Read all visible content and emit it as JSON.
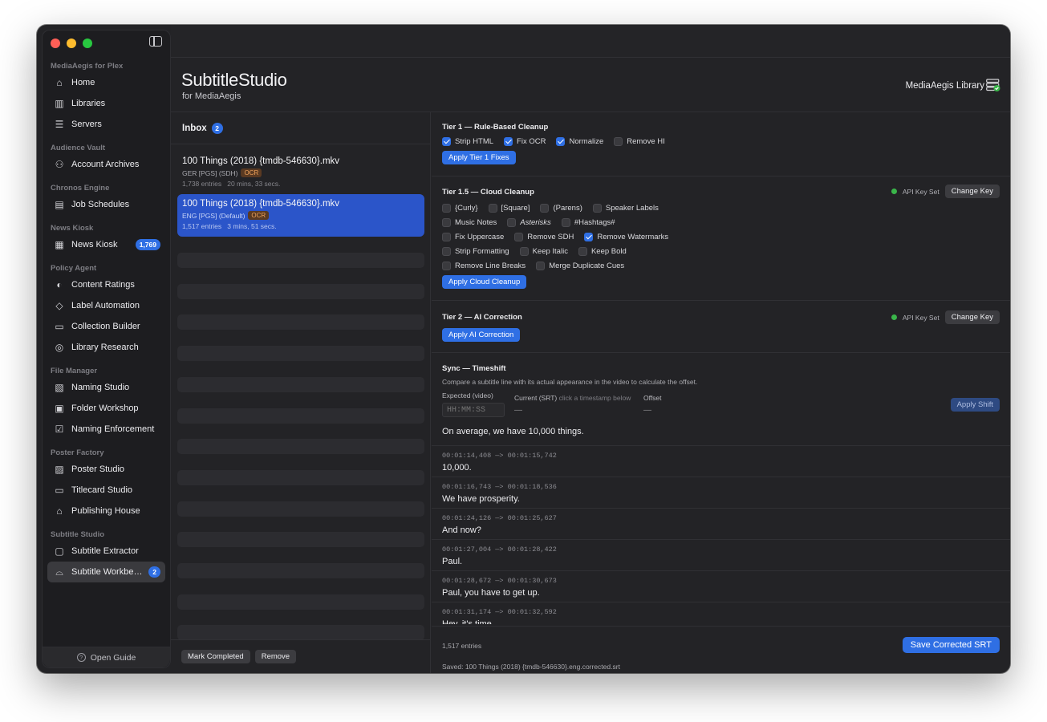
{
  "sidebar": {
    "sections": [
      {
        "title": "MediaAegis for Plex",
        "items": [
          {
            "label": "Home",
            "icon": "⌂"
          },
          {
            "label": "Libraries",
            "icon": "▥"
          },
          {
            "label": "Servers",
            "icon": "☰"
          }
        ]
      },
      {
        "title": "Audience Vault",
        "items": [
          {
            "label": "Account Archives",
            "icon": "⚇"
          }
        ]
      },
      {
        "title": "Chronos Engine",
        "items": [
          {
            "label": "Job Schedules",
            "icon": "▤"
          }
        ]
      },
      {
        "title": "News Kiosk",
        "items": [
          {
            "label": "News Kiosk",
            "icon": "▦",
            "badge": "1,769"
          }
        ]
      },
      {
        "title": "Policy Agent",
        "items": [
          {
            "label": "Content Ratings",
            "icon": "◐"
          },
          {
            "label": "Label Automation",
            "icon": "◇"
          },
          {
            "label": "Collection Builder",
            "icon": "▭"
          },
          {
            "label": "Library Research",
            "icon": "◎"
          }
        ]
      },
      {
        "title": "File Manager",
        "items": [
          {
            "label": "Naming Studio",
            "icon": "▧"
          },
          {
            "label": "Folder Workshop",
            "icon": "▣"
          },
          {
            "label": "Naming Enforcement",
            "icon": "☑"
          }
        ]
      },
      {
        "title": "Poster Factory",
        "items": [
          {
            "label": "Poster Studio",
            "icon": "▨"
          },
          {
            "label": "Titlecard Studio",
            "icon": "▭"
          },
          {
            "label": "Publishing House",
            "icon": "⌂"
          }
        ]
      },
      {
        "title": "Subtitle Studio",
        "items": [
          {
            "label": "Subtitle Extractor",
            "icon": "▢"
          },
          {
            "label": "Subtitle Workbe…",
            "icon": "⌓",
            "badge": "2",
            "active": true
          }
        ]
      }
    ],
    "footer_label": "Open Guide"
  },
  "header": {
    "title": "SubtitleStudio",
    "subtitle": "for MediaAegis",
    "library": "MediaAegis Library"
  },
  "inbox": {
    "title": "Inbox",
    "count": "2",
    "files": [
      {
        "name": "100 Things (2018) {tmdb-546630}.mkv",
        "meta": "GER [PGS] (SDH)",
        "tag": "OCR",
        "stats": "1,738 entries   20 mins, 33 secs."
      },
      {
        "name": "100 Things (2018) {tmdb-546630}.mkv",
        "meta": "ENG [PGS] (Default)",
        "tag": "OCR",
        "stats": "1,517 entries   3 mins, 51 secs."
      }
    ],
    "mark_completed": "Mark Completed",
    "remove": "Remove"
  },
  "tier1": {
    "title": "Tier 1 — Rule-Based Cleanup",
    "options": [
      {
        "label": "Strip HTML",
        "checked": true
      },
      {
        "label": "Fix OCR",
        "checked": true
      },
      {
        "label": "Normalize",
        "checked": true
      },
      {
        "label": "Remove HI",
        "checked": false
      }
    ],
    "apply": "Apply Tier 1 Fixes"
  },
  "tier15": {
    "title": "Tier 1.5 — Cloud Cleanup",
    "api_status": "API Key Set",
    "change_key": "Change Key",
    "rows": [
      [
        {
          "label": "{Curly}",
          "checked": false
        },
        {
          "label": "[Square]",
          "checked": false
        },
        {
          "label": "(Parens)",
          "checked": false
        },
        {
          "label": "Speaker Labels",
          "checked": false
        }
      ],
      [
        {
          "label": "Music Notes",
          "checked": false
        },
        {
          "label": "Asterisks",
          "checked": false,
          "italic": true
        },
        {
          "label": "#Hashtags#",
          "checked": false
        }
      ],
      [
        {
          "label": "Fix Uppercase",
          "checked": false
        },
        {
          "label": "Remove SDH",
          "checked": false
        },
        {
          "label": "Remove Watermarks",
          "checked": true
        }
      ],
      [
        {
          "label": "Strip Formatting",
          "checked": false
        },
        {
          "label": "Keep Italic",
          "checked": false
        },
        {
          "label": "Keep Bold",
          "checked": false
        }
      ],
      [
        {
          "label": "Remove Line Breaks",
          "checked": false
        },
        {
          "label": "Merge Duplicate Cues",
          "checked": false
        }
      ]
    ],
    "apply": "Apply Cloud Cleanup"
  },
  "tier2": {
    "title": "Tier 2 — AI Correction",
    "api_status": "API Key Set",
    "change_key": "Change Key",
    "apply": "Apply AI Correction"
  },
  "sync": {
    "title": "Sync — Timeshift",
    "description": "Compare a subtitle line with its actual appearance in the video to calculate the offset.",
    "expected_label": "Expected (video)",
    "expected_placeholder": "HH:MM:SS",
    "current_label": "Current (SRT)",
    "current_hint": "click a timestamp below",
    "current_value": "—",
    "offset_label": "Offset",
    "offset_value": "—",
    "apply": "Apply Shift"
  },
  "cues": [
    {
      "ts": "",
      "text": "On average, we have 10,000 things."
    },
    {
      "ts": "00:01:14,408 —> 00:01:15,742",
      "text": "10,000."
    },
    {
      "ts": "00:01:16,743 —> 00:01:18,536",
      "text": "We have prosperity."
    },
    {
      "ts": "00:01:24,126 —> 00:01:25,627",
      "text": "And now?"
    },
    {
      "ts": "00:01:27,004 —> 00:01:28,422",
      "text": "Paul."
    },
    {
      "ts": "00:01:28,672 —> 00:01:30,673",
      "text": "Paul, you have to get up."
    },
    {
      "ts": "00:01:31,174 —> 00:01:32,592",
      "text": "Hey, it's time."
    }
  ],
  "footer": {
    "entries": "1,517 entries",
    "saved": "Saved: 100 Things (2018) {tmdb-546630}.eng.corrected.srt",
    "save_button": "Save Corrected SRT"
  },
  "colors": {
    "accent": "#2f6fe4",
    "selected": "#2b55c9",
    "ok": "#3ab54a",
    "ocr": "#f0a35b"
  }
}
